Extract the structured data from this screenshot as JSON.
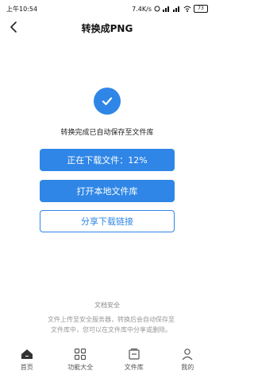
{
  "status_bar": {
    "time": "上午10:54",
    "network_speed": "7.4K/s",
    "battery": "73"
  },
  "header": {
    "title": "转换成PNG"
  },
  "result": {
    "message": "转换完成已自动保存至文件库"
  },
  "buttons": {
    "download_label": "正在下载文件：12%",
    "download_progress": 12,
    "open_local_label": "打开本地文件库",
    "share_link_label": "分享下载链接"
  },
  "security": {
    "title": "文档安全",
    "description": "文件上传至安全服务器，转换后会自动保存至文件库中，您可以在文件库中分享或删除。"
  },
  "tabs": [
    {
      "label": "首页",
      "icon": "home-icon"
    },
    {
      "label": "功能大全",
      "icon": "grid-icon"
    },
    {
      "label": "文件库",
      "icon": "folder-icon"
    },
    {
      "label": "我的",
      "icon": "user-icon"
    }
  ],
  "colors": {
    "accent": "#2f86e6"
  }
}
